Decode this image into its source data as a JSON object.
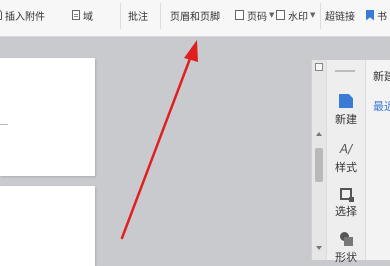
{
  "ribbon": {
    "insert_attachment": "插入附件",
    "field": "域",
    "comment": "批注",
    "header_footer": "页眉和页脚",
    "page_number": "页码",
    "watermark": "水印",
    "hyperlink": "超链接",
    "bookmark_partial": "书"
  },
  "side_pane": {
    "tabs": [
      {
        "label": "新建",
        "icon": "new-doc-icon"
      },
      {
        "label": "样式",
        "icon": "style-icon"
      },
      {
        "label": "选择",
        "icon": "select-icon"
      },
      {
        "label": "形状",
        "icon": "shape-icon"
      }
    ],
    "content_title": "新建",
    "content_link": "最近"
  },
  "annotation": {
    "color": "#e02020"
  }
}
